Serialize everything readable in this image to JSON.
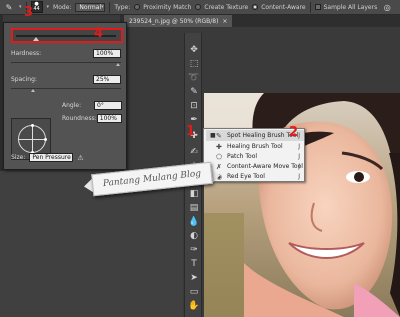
{
  "options_bar": {
    "brush_size": "44",
    "mode_label": "Mode:",
    "mode_value": "Normal",
    "type_label": "Type:",
    "proximity_label": "Proximity Match",
    "texture_label": "Create Texture",
    "content_aware_label": "Content-Aware",
    "sample_all_label": "Sample All Layers"
  },
  "document_tab": {
    "title": "239524_n.jpg @ 50% (RGB/8)",
    "close": "×"
  },
  "brush_panel": {
    "size_label": "Size:",
    "hardness_label": "Hardness:",
    "hardness_value": "100%",
    "spacing_label": "Spacing:",
    "spacing_value": "25%",
    "angle_label": "Angle:",
    "angle_value": "0°",
    "roundness_label": "Roundness:",
    "roundness_value": "100%",
    "pressure_value": "Pen Pressure"
  },
  "flyout": {
    "items": [
      {
        "label": "Spot Healing Brush Tool",
        "key": "J",
        "selected": true
      },
      {
        "label": "Healing Brush Tool",
        "key": "J",
        "selected": false
      },
      {
        "label": "Patch Tool",
        "key": "J",
        "selected": false
      },
      {
        "label": "Content-Aware Move Tool",
        "key": "J",
        "selected": false
      },
      {
        "label": "Red Eye Tool",
        "key": "J",
        "selected": false
      }
    ]
  },
  "annotations": {
    "n1": "1",
    "n2": "2",
    "n3": "3",
    "n4": "4"
  },
  "watermark": "Pantang Mulang Blog",
  "colors": {
    "annotation_red": "#e01b1b",
    "panel_bg": "#535353",
    "toolbar_bg": "#424242"
  }
}
